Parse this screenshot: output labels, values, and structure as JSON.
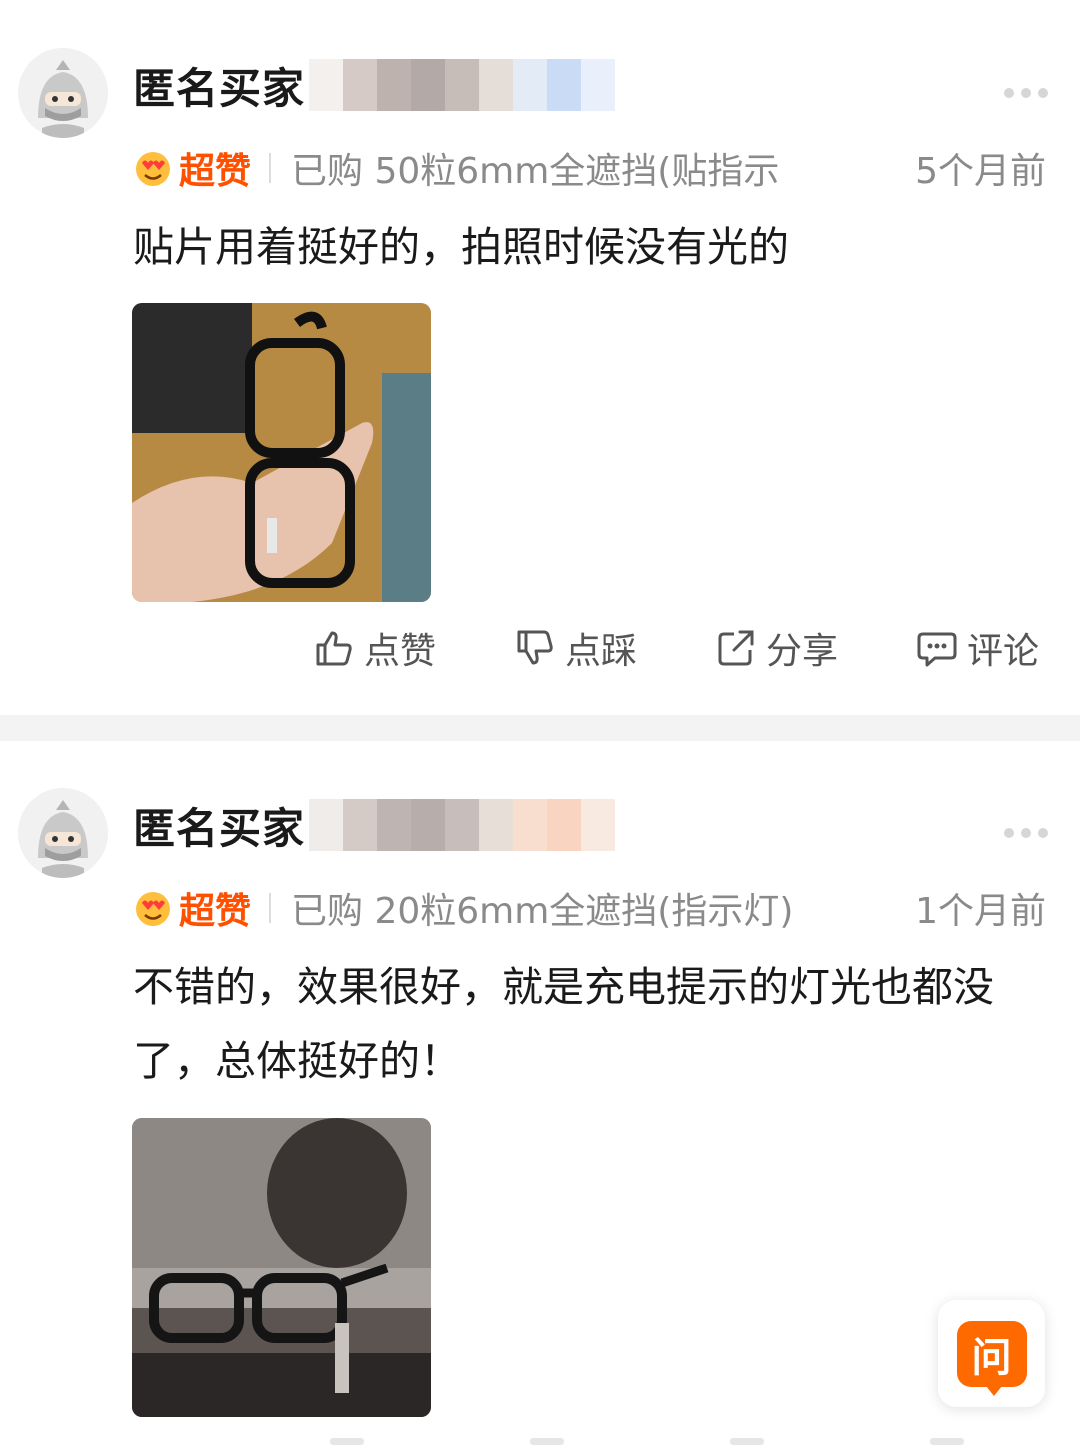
{
  "reviews": [
    {
      "user": "匿名买家",
      "rating_label": "超赞",
      "rating_icon": "heart-eyes-emoji",
      "spec": "已购 50粒6mm全遮挡(贴指示",
      "time": "5个月前",
      "text": "贴片用着挺好的，拍照时候没有光的",
      "actions": {
        "like": "点赞",
        "dislike": "点踩",
        "share": "分享",
        "comment": "评论"
      }
    },
    {
      "user": "匿名买家",
      "rating_label": "超赞",
      "rating_icon": "heart-eyes-emoji",
      "spec": "已购 20粒6mm全遮挡(指示灯)",
      "time": "1个月前",
      "text": "不错的，效果很好，就是充电提示的灯光也都没了，总体挺好的！"
    }
  ],
  "ask_button": {
    "label": "问"
  },
  "colors": {
    "accent": "#ff5000",
    "ask": "#ff6a00",
    "muted": "#8a8a8a"
  }
}
